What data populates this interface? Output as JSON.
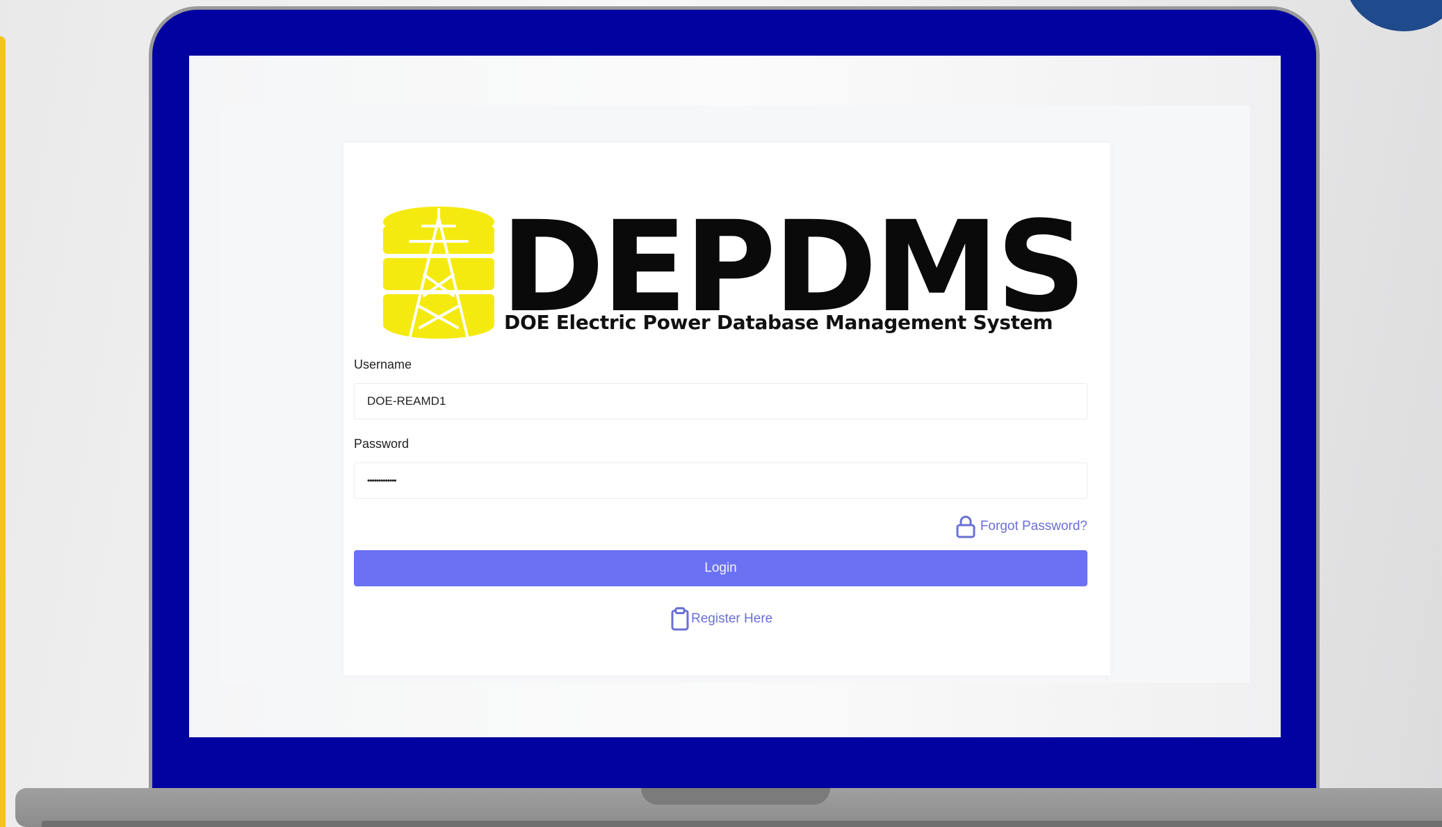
{
  "colors": {
    "laptop_frame": "#0202a0",
    "accent": "#6a71f3",
    "link": "#6a6fd6",
    "logo_yellow": "#f5ea10"
  },
  "app": {
    "logo_text": "DEPDMS",
    "logo_subtitle": "DOE Electric Power Database Management System"
  },
  "form": {
    "username_label": "Username",
    "username_value": "DOE-REAMD1",
    "password_label": "Password",
    "password_value": "•••••••••••••",
    "forgot_label": "Forgot Password?",
    "login_label": "Login",
    "register_label": "Register Here"
  },
  "icons": {
    "forgot": "lock-icon",
    "register": "clipboard-icon",
    "logo": "power-tower-database-icon"
  }
}
